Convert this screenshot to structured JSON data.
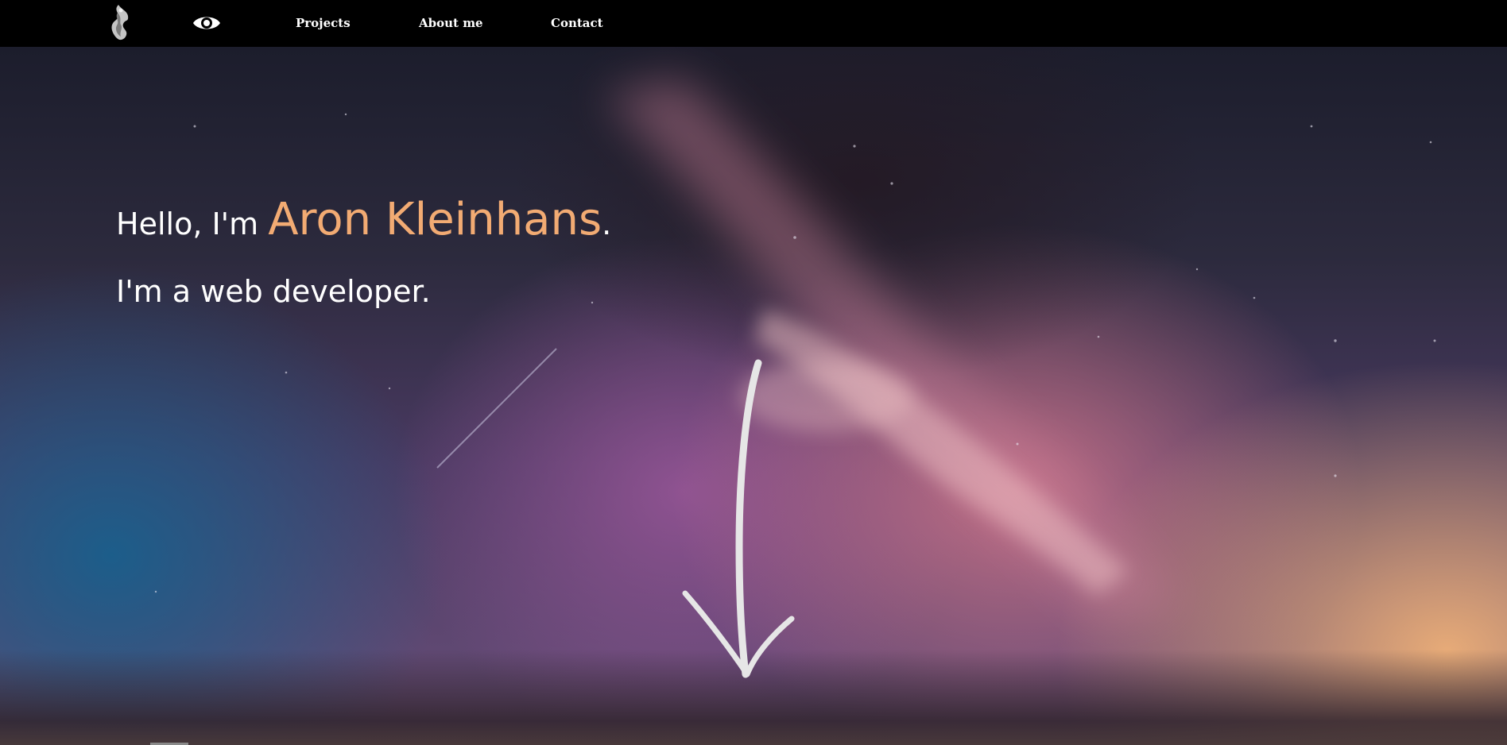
{
  "nav": {
    "logo_icon": "flame-figure-logo",
    "eye_icon": "eye-icon",
    "links": [
      {
        "label": "Projects"
      },
      {
        "label": "About me"
      },
      {
        "label": "Contact"
      }
    ]
  },
  "hero": {
    "greeting_prefix": "Hello, I'm",
    "name": "Aron Kleinhans",
    "greeting_suffix": ".",
    "tagline": "I'm a web developer.",
    "scroll_icon": "arrow-down-icon"
  },
  "colors": {
    "nav_background": "#000000",
    "accent": "#f2ab73",
    "text": "#ffffff"
  }
}
